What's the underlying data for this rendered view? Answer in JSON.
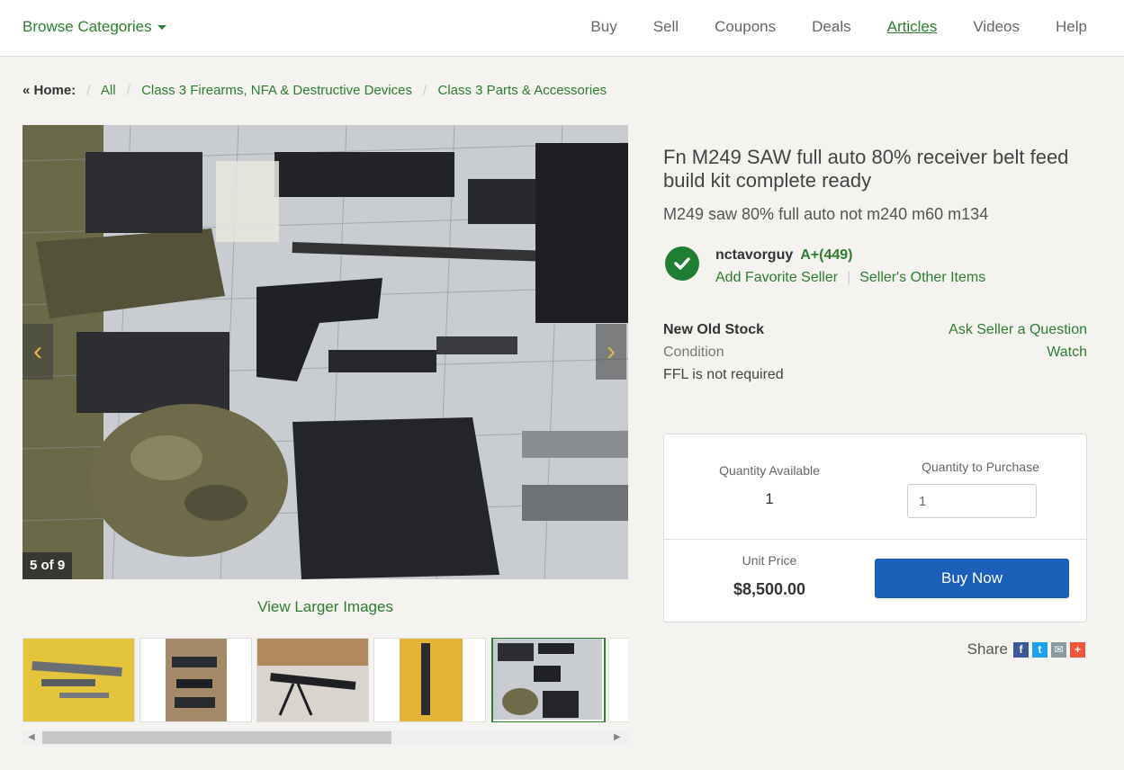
{
  "nav": {
    "browse_label": "Browse Categories",
    "links": [
      "Buy",
      "Sell",
      "Coupons",
      "Deals",
      "Articles",
      "Videos",
      "Help"
    ],
    "active": "Articles"
  },
  "breadcrumb": {
    "home": "« Home:",
    "items": [
      "All",
      "Class 3 Firearms, NFA & Destructive Devices",
      "Class 3 Parts & Accessories"
    ]
  },
  "gallery": {
    "counter": "5 of 9",
    "view_larger": "View Larger Images",
    "prev_icon": "chevron-left-icon",
    "next_icon": "chevron-right-icon",
    "thumbnail_count": 6,
    "selected_index": 4
  },
  "listing": {
    "title": "Fn M249 SAW full auto 80% receiver belt feed build kit complete ready",
    "subtitle": "M249 saw 80% full auto not m240 m60 m134"
  },
  "seller": {
    "name": "nctavorguy",
    "rating": "A+(449)",
    "add_favorite": "Add Favorite Seller",
    "other_items": "Seller's Other Items",
    "verified_icon": "checkmark-circle-icon"
  },
  "details": {
    "condition_value": "New Old Stock",
    "condition_label": "Condition",
    "ffl": "FFL is not required",
    "ask_question": "Ask Seller a Question",
    "watch": "Watch"
  },
  "purchase": {
    "qty_available_label": "Quantity Available",
    "qty_available": "1",
    "qty_purchase_label": "Quantity to Purchase",
    "qty_purchase_value": "1",
    "unit_price_label": "Unit Price",
    "unit_price": "$8,500.00",
    "buy_now": "Buy Now"
  },
  "share": {
    "label": "Share",
    "icons": [
      "facebook-icon",
      "twitter-icon",
      "email-icon",
      "more-icon"
    ]
  },
  "colors": {
    "link_green": "#2e7d32",
    "buy_blue": "#1b5fb8",
    "check_green": "#1e7e34"
  }
}
